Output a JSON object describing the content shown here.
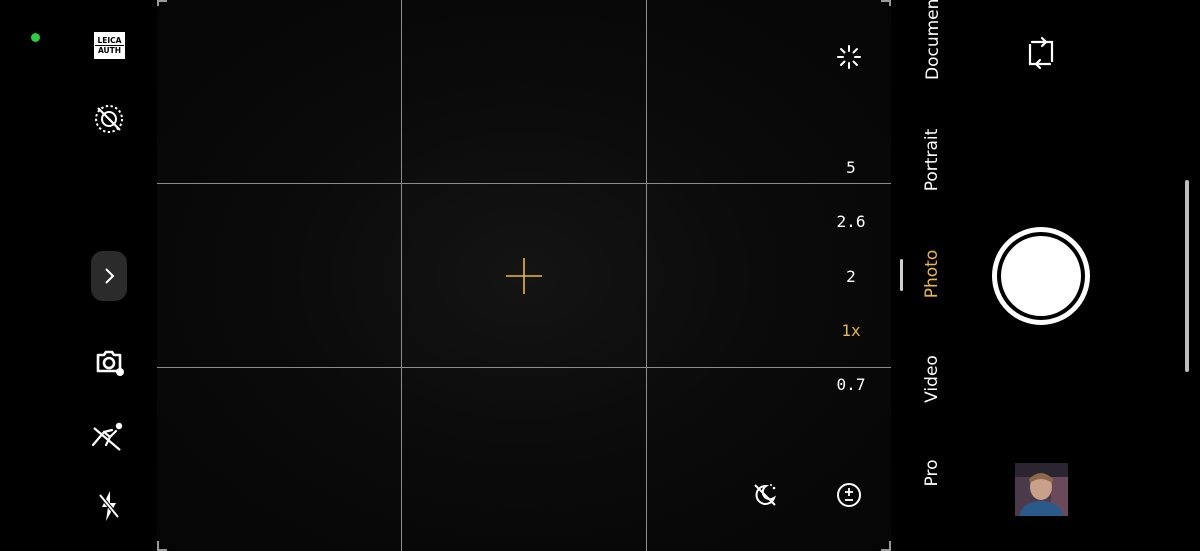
{
  "status": {
    "indicator_color": "#2ecc40"
  },
  "left_toolbar": {
    "leica_badge": {
      "line1": "LEICA",
      "line2": "AUTH"
    },
    "icons": [
      "leica-auth-icon",
      "live-photo-off-icon",
      "expand-chevron-icon",
      "lens-scan-icon",
      "motion-icon",
      "flash-off-icon"
    ]
  },
  "viewfinder": {
    "focus_color": "#e8b84a",
    "right_icons": [
      "ai-scene-icon",
      "night-off-icon",
      "exposure-compensation-icon"
    ]
  },
  "zoom": {
    "levels": [
      "5",
      "2.6",
      "2",
      "1x",
      "0.7"
    ],
    "selected": "1x",
    "active_color": "#e8b84a"
  },
  "modes": {
    "items": [
      "Document",
      "Portrait",
      "Photo",
      "Video",
      "Pro"
    ],
    "selected": "Photo"
  },
  "right_panel": {
    "icons": [
      "switch-camera-icon",
      "shutter-button",
      "gallery-thumbnail"
    ]
  }
}
